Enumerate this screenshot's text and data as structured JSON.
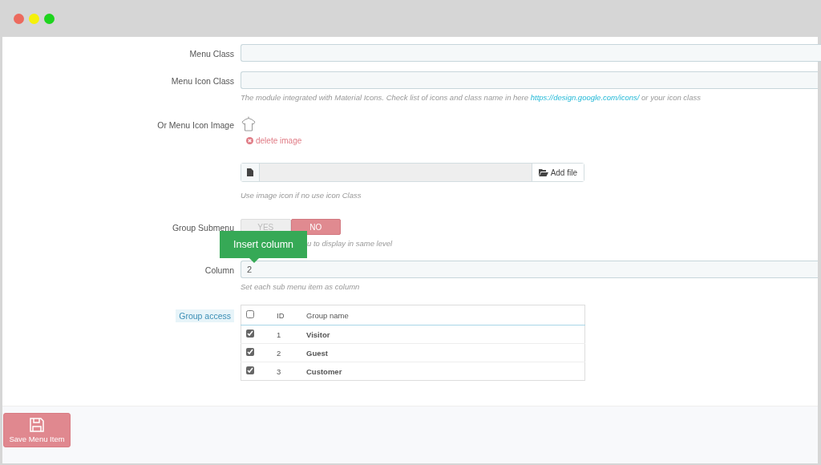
{
  "window": {
    "controls": [
      {
        "color": "#ec6a5e"
      },
      {
        "color": "#f5f10a"
      },
      {
        "color": "#1ed41e"
      }
    ]
  },
  "form": {
    "menu_class": {
      "label": "Menu Class"
    },
    "menu_icon_class": {
      "label": "Menu Icon Class",
      "help_before": "The module integrated with Material Icons. Check list of icons and class name in here ",
      "help_link": "https://design.google.com/icons/",
      "help_after": " or your icon class"
    },
    "icon_image": {
      "label": "Or Menu Icon Image",
      "delete": "delete image",
      "button": "Add file",
      "help": "Use image icon if no use icon Class"
    },
    "group_submenu": {
      "label": "Group Submenu",
      "options": [
        {
          "label": "YES",
          "selected": false
        },
        {
          "label": "NO",
          "selected": true
        }
      ],
      "help": "u to display in same level"
    },
    "tooltip": "Insert column",
    "column": {
      "label": "Column",
      "value": "2",
      "help": "Set each sub menu item as column"
    },
    "group_access": {
      "label": "Group access",
      "all_checked": false,
      "columns": [
        "ID",
        "Group name"
      ],
      "rows": [
        {
          "id": "1",
          "name": "Visitor",
          "checked": true
        },
        {
          "id": "2",
          "name": "Guest",
          "checked": true
        },
        {
          "id": "3",
          "name": "Customer",
          "checked": true
        }
      ]
    }
  },
  "save_button": "Save Menu Item"
}
